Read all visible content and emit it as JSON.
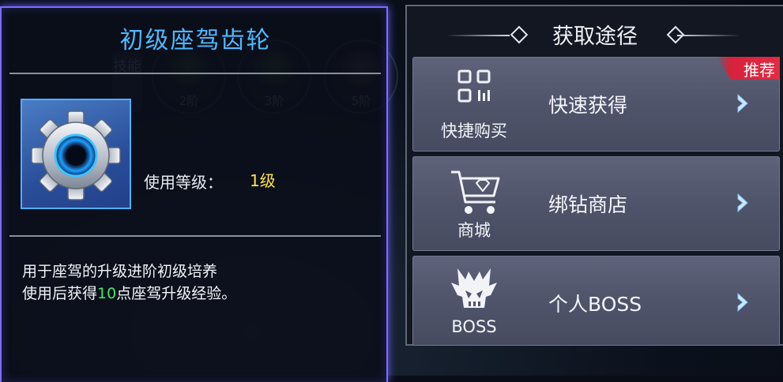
{
  "background": {
    "skill_tab": "技能",
    "stages": [
      "2阶",
      "3阶",
      "5阶"
    ]
  },
  "item": {
    "title": "初级座驾齿轮",
    "icon": "gear-icon",
    "level_label": "使用等级：",
    "level_value": "1级",
    "description_line1": "用于座驾的升级进阶初级培养",
    "description_line2_prefix": "使用后获得",
    "description_line2_highlight": "10",
    "description_line2_suffix": "点座驾升级经验。"
  },
  "acquire": {
    "title": "获取途径",
    "routes": [
      {
        "icon": "qr-code-icon",
        "icon_label": "快捷购买",
        "label": "快速获得",
        "badge": "推荐"
      },
      {
        "icon": "shopping-cart-icon",
        "icon_label": "商城",
        "label": "绑钻商店"
      },
      {
        "icon": "boss-skull-icon",
        "icon_label": "BOSS",
        "label": "个人BOSS"
      }
    ]
  },
  "colors": {
    "panel_border": "#7d6cff",
    "title_blue": "#4fb8ff",
    "level_yellow": "#ffe54a",
    "highlight_green": "#43e86a",
    "badge_red": "#e42a43"
  }
}
